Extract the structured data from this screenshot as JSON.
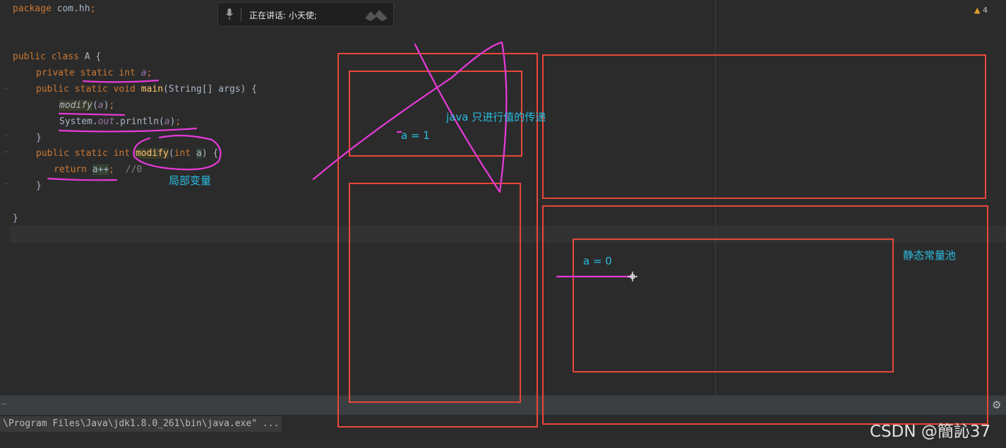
{
  "speech": {
    "status": "正在讲话:  小天使;"
  },
  "warnings": {
    "count": "4"
  },
  "code": {
    "package": {
      "kw": "package",
      "name": " com.hh",
      "semi": ";"
    },
    "class_decl": {
      "kw": "public class",
      "rest": " A {"
    },
    "field": {
      "kw1": "private",
      "kw2": "static",
      "kw3": "int",
      "name": "a",
      "semi": ";"
    },
    "main_decl": {
      "kw": "public static void",
      "name": "main",
      "params": "(String[] args) {"
    },
    "modify_call": {
      "name": "modify",
      "open": "(",
      "arg": "a",
      "close": ")",
      "semi": ";"
    },
    "println": {
      "obj": "System.",
      "field": "out",
      "call": ".println(",
      "arg": "a",
      "close": ")",
      "semi": ";"
    },
    "brace1": "}",
    "modify_decl": {
      "kw": "public static int",
      "name": "modify",
      "open": "(",
      "ptype": "int",
      "pname": "a",
      "rest": ") {"
    },
    "return_stmt": {
      "kw": "return",
      "expr": "a++",
      "semi": ";",
      "comment": "//0"
    },
    "brace2": "}",
    "brace3": "}"
  },
  "annotations": {
    "local_var": "局部变量",
    "java_pass": "java 只进行值的传递",
    "a_eq_1": "a  =  1",
    "a_eq_0": "a = 0",
    "static_pool": "静态常量池"
  },
  "console": {
    "run_line": "\\Program Files\\Java\\jdk1.8.0_261\\bin\\java.exe\" ..."
  },
  "watermark": "CSDN @簡訫37",
  "colors": {
    "annotation_red": "#e8473a",
    "annotation_magenta": "#e83ad8",
    "annotation_cyan": "#29bde0"
  }
}
